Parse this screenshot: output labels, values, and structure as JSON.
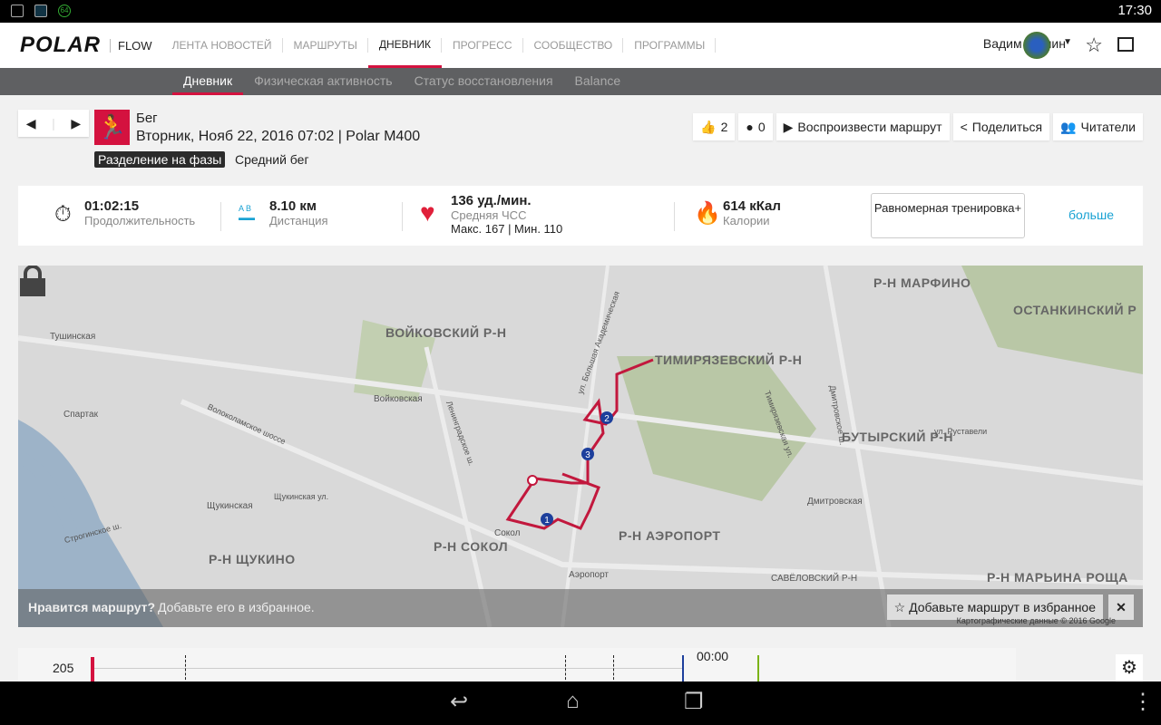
{
  "status_bar": {
    "time": "17:30",
    "notif_badge": "64"
  },
  "header": {
    "logo": "POLAR",
    "product": "FLOW",
    "nav": [
      "ЛЕНТА НОВОСТЕЙ",
      "МАРШРУТЫ",
      "ДНЕВНИК",
      "ПРОГРЕСС",
      "СООБЩЕСТВО",
      "ПРОГРАММЫ"
    ],
    "active_nav": "ДНЕВНИК",
    "user": "Вадим Жилин"
  },
  "subnav": {
    "items": [
      "Дневник",
      "Физическая активность",
      "Статус восстановления",
      "Balance"
    ],
    "active": "Дневник"
  },
  "session": {
    "sport": "Бег",
    "date": "Вторник, Нояб 22, 2016 07:02 | Polar M400",
    "phase_label": "Разделение на фазы",
    "phase_value": "Средний бег"
  },
  "actions": {
    "likes": "2",
    "comments": "0",
    "replay": "Воспроизвести маршрут",
    "share": "Поделиться",
    "followers": "Читатели"
  },
  "stats": {
    "duration": "01:02:15",
    "duration_label": "Продолжительность",
    "distance": "8.10 км",
    "distance_label": "Дистанция",
    "hr": "136 уд./мин.",
    "hr_label": "Средняя ЧСС",
    "hr_minmax": "Макс. 167  |  Мин. 110",
    "calories": "614 кКал",
    "calories_label": "Калории",
    "training_button": "Равномерная тренировка+",
    "more": "больше"
  },
  "map": {
    "districts": [
      "ВОЙКОВСКИЙ Р-Н",
      "ТИМИРЯЗЕВСКИЙ Р-Н",
      "Р-Н МАРФИНО",
      "ОСТАНКИНСКИЙ Р",
      "БУТЫРСКИЙ Р-Н",
      "Р-Н АЭРОПОРТ",
      "Р-Н СОКОЛ",
      "Р-Н ЩУКИНО",
      "Р-Н МАРЬИНА РОЩА",
      "САВЁЛОВСКИЙ Р-Н"
    ],
    "stations": [
      "Тушинская",
      "Спартак",
      "Войковская",
      "Щукинская",
      "Сокол",
      "Аэропорт",
      "Дмитровская"
    ],
    "streets": [
      "Волоколамское шоссе",
      "Щукинская ул.",
      "Строгинское ш.",
      "Ленинградское ш.",
      "ул. Большая Академическая",
      "ул. Руставели",
      "Дмитровское ш.",
      "Тимирязевская ул."
    ],
    "markers": [
      "1",
      "2",
      "3"
    ],
    "route_color": "#c2183d",
    "prompt_q": "Нравится маршрут?",
    "prompt_hint": "Добавьте его в избранное.",
    "fav_button": "Добавьте маршрут в избранное",
    "close": "✕",
    "attribution": "Картографические данные © 2016 Google",
    "google": "Google"
  },
  "chart": {
    "y_tick": "205",
    "time": "00:00"
  },
  "colors": {
    "accent": "#d4123f",
    "link": "#19a2d3"
  }
}
